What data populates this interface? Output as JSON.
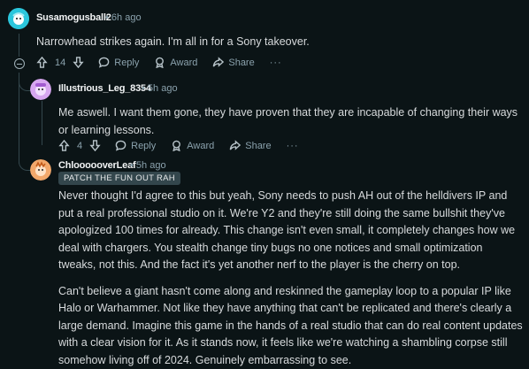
{
  "comments": [
    {
      "username": "Susamogusball2",
      "time": "6h ago",
      "text": "Narrowhead strikes again. I'm all in for a Sony takeover.",
      "votes": "14",
      "reply": "Reply",
      "award": "Award",
      "share": "Share",
      "more": "···"
    },
    {
      "username": "Illustrious_Leg_8354",
      "time": "5h ago",
      "text": "Me aswell. I want them gone, they have proven that they are incapable of changing their ways or learning lessons.",
      "votes": "4",
      "reply": "Reply",
      "award": "Award",
      "share": "Share",
      "more": "···"
    },
    {
      "username": "ChloooooverLeaf",
      "time": "5h ago",
      "flair": "PATCH THE FUN OUT RAH",
      "paragraphs": [
        "Never thought I'd agree to this but yeah, Sony needs to push AH out of the helldivers IP and put a real professional studio on it. We're Y2 and they're still doing the same bullshit they've apologized 100 times for already. This change isn't even small, it completely changes how we deal with chargers. You stealth change tiny bugs no one notices and small optimization tweaks, not this. And the fact it's yet another nerf to the player is the cherry on top.",
        "Can't believe a giant hasn't come along and reskinned the gameplay loop to a popular IP like Halo or Warhammer. Not like they have anything that can't be replicated and there's clearly a large demand. Imagine this game in the hands of a real studio that can do real content updates with a clear vision for it. As it stands now, it feels like we're watching a shambling corpse still somehow living off of 2024. Genuinely embarrassing to see."
      ]
    }
  ],
  "separator": "•"
}
